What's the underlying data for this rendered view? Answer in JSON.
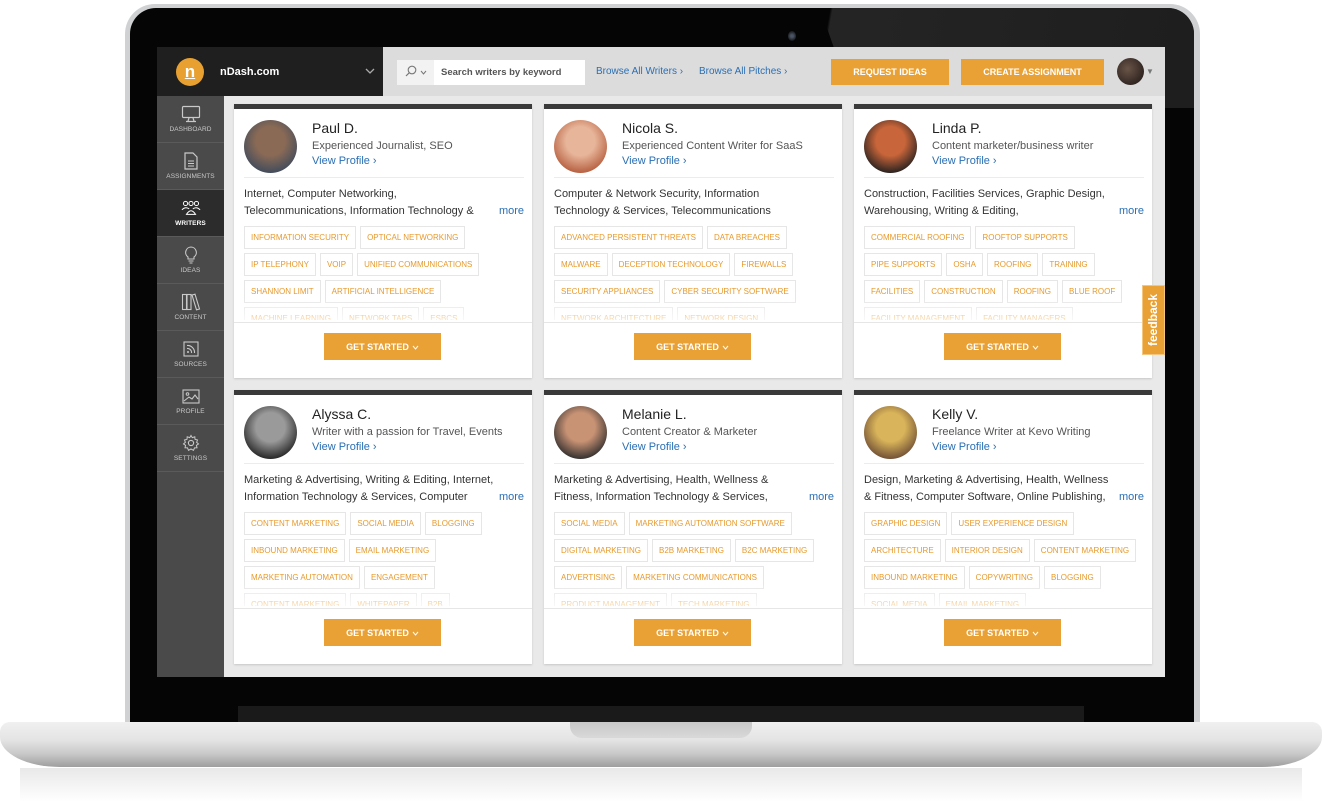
{
  "brand": {
    "logo_letter": "n",
    "name": "nDash.com"
  },
  "search": {
    "placeholder": "Search writers by keyword",
    "value": ""
  },
  "nav": {
    "browse_writers": "Browse All Writers ›",
    "browse_pitches": "Browse All Pitches ›",
    "request_ideas": "REQUEST IDEAS",
    "create_assignment": "CREATE ASSIGNMENT"
  },
  "sidebar": {
    "items": [
      {
        "label": "DASHBOARD",
        "icon": "monitor-icon",
        "active": false
      },
      {
        "label": "ASSIGNMENTS",
        "icon": "document-icon",
        "active": false
      },
      {
        "label": "WRITERS",
        "icon": "users-icon",
        "active": true
      },
      {
        "label": "IDEAS",
        "icon": "lightbulb-icon",
        "active": false
      },
      {
        "label": "CONTENT",
        "icon": "books-icon",
        "active": false
      },
      {
        "label": "SOURCES",
        "icon": "rss-icon",
        "active": false
      },
      {
        "label": "PROFILE",
        "icon": "image-icon",
        "active": false
      },
      {
        "label": "SETTINGS",
        "icon": "gear-icon",
        "active": false
      }
    ]
  },
  "writers": [
    {
      "name": "Paul D.",
      "headline": "Experienced Journalist, SEO",
      "view_profile": "View Profile ›",
      "industries": "Internet, Computer Networking, Telecommunications, Information Technology & Services, Computer Software",
      "more": "more",
      "avatar_colors": [
        "#8a6a55",
        "#3d4a5c"
      ],
      "tags": [
        "INFORMATION SECURITY",
        "OPTICAL NETWORKING",
        "IP TELEPHONY",
        "VOIP",
        "UNIFIED COMMUNICATIONS",
        "SHANNON LIMIT",
        "ARTIFICIAL INTELLIGENCE",
        "MACHINE LEARNING",
        "NETWORK TAPS",
        "ESBCS"
      ],
      "cta": "GET STARTED"
    },
    {
      "name": "Nicola S.",
      "headline": "Experienced Content Writer for SaaS",
      "view_profile": "View Profile ›",
      "industries": "Computer & Network Security, Information Technology & Services, Telecommunications",
      "more": "",
      "avatar_colors": [
        "#e7b59a",
        "#b35a3a"
      ],
      "tags": [
        "ADVANCED PERSISTENT THREATS",
        "DATA BREACHES",
        "MALWARE",
        "DECEPTION TECHNOLOGY",
        "FIREWALLS",
        "SECURITY APPLIANCES",
        "CYBER SECURITY SOFTWARE",
        "NETWORK ARCHITECTURE",
        "NETWORK DESIGN"
      ],
      "cta": "GET STARTED"
    },
    {
      "name": "Linda P.",
      "headline": "Content marketer/business writer",
      "view_profile": "View Profile ›",
      "industries": "Construction, Facilities Services, Graphic Design, Warehousing, Writing & Editing, Telecommunications",
      "more": "more",
      "avatar_colors": [
        "#c9653a",
        "#1e1e1e"
      ],
      "tags": [
        "COMMERCIAL ROOFING",
        "ROOFTOP SUPPORTS",
        "PIPE SUPPORTS",
        "OSHA",
        "ROOFING",
        "TRAINING",
        "FACILITIES",
        "CONSTRUCTION",
        "ROOFING",
        "BLUE ROOF",
        "FACILITY MANAGEMENT",
        "FACILITY MANAGERS"
      ],
      "cta": "GET STARTED"
    },
    {
      "name": "Alyssa C.",
      "headline": "Writer with a passion for Travel, Events",
      "view_profile": "View Profile ›",
      "industries": "Marketing & Advertising, Writing & Editing, Internet, Information Technology & Services, Computer Software",
      "more": "more",
      "avatar_colors": [
        "#9a9a9a",
        "#1f1f1f"
      ],
      "tags": [
        "CONTENT MARKETING",
        "SOCIAL MEDIA",
        "BLOGGING",
        "INBOUND MARKETING",
        "EMAIL MARKETING",
        "MARKETING AUTOMATION",
        "ENGAGEMENT",
        "CONTENT MARKETING",
        "WHITEPAPER",
        "B2B"
      ],
      "cta": "GET STARTED"
    },
    {
      "name": "Melanie L.",
      "headline": "Content Creator & Marketer",
      "view_profile": "View Profile ›",
      "industries": "Marketing & Advertising, Health, Wellness & Fitness, Information Technology & Services, Writing & Editing",
      "more": "more",
      "avatar_colors": [
        "#c89274",
        "#2a2a2a"
      ],
      "tags": [
        "SOCIAL MEDIA",
        "MARKETING AUTOMATION SOFTWARE",
        "DIGITAL MARKETING",
        "B2B MARKETING",
        "B2C MARKETING",
        "ADVERTISING",
        "MARKETING COMMUNICATIONS",
        "PRODUCT MANAGEMENT",
        "TECH MARKETING"
      ],
      "cta": "GET STARTED"
    },
    {
      "name": "Kelly V.",
      "headline": "Freelance Writer at Kevo Writing",
      "view_profile": "View Profile ›",
      "industries": "Design, Marketing & Advertising, Health, Wellness & Fitness, Computer Software, Online Publishing,",
      "more": "more",
      "avatar_colors": [
        "#d9b45a",
        "#6b4a33"
      ],
      "tags": [
        "GRAPHIC DESIGN",
        "USER EXPERIENCE DESIGN",
        "ARCHITECTURE",
        "INTERIOR DESIGN",
        "CONTENT MARKETING",
        "INBOUND MARKETING",
        "COPYWRITING",
        "BLOGGING",
        "SOCIAL MEDIA",
        "EMAIL MARKETING"
      ],
      "cta": "GET STARTED"
    }
  ],
  "feedback": "feedback",
  "colors": {
    "accent": "#e9a135",
    "link": "#2a6fb5",
    "sidebar": "#4a4a4a",
    "topbar_brand": "#1f1f1f"
  }
}
